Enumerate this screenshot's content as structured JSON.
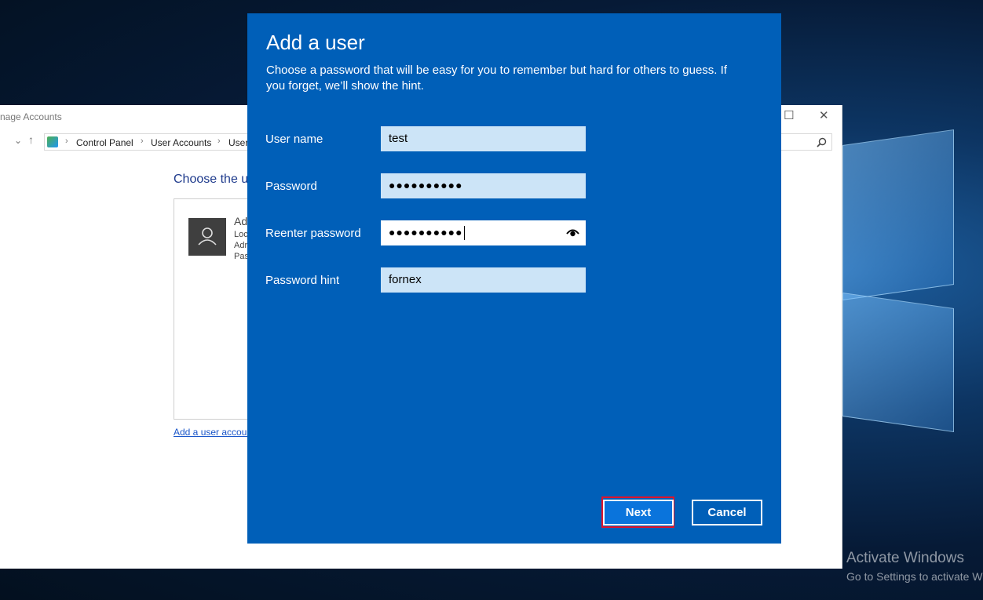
{
  "background_window": {
    "title": "nage Accounts",
    "breadcrumb": [
      "Control Panel",
      "User Accounts",
      "User"
    ],
    "heading": "Choose the us",
    "account_name": "Ad",
    "account_lines": [
      "Loc",
      "Adr",
      "Pas"
    ],
    "add_link": "Add a user accoun"
  },
  "dialog": {
    "title": "Add a user",
    "description": "Choose a password that will be easy for you to remember but hard for others to guess. If you forget, we’ll show the hint.",
    "fields": [
      {
        "label": "User name",
        "value": "test"
      },
      {
        "label": "Password",
        "value": "●●●●●●●●●●"
      },
      {
        "label": "Reenter password",
        "value": "●●●●●●●●●●"
      },
      {
        "label": "Password hint",
        "value": "fornex"
      }
    ],
    "next_label": "Next",
    "cancel_label": "Cancel"
  },
  "watermark": {
    "title": "Activate Windows",
    "subtitle": "Go to Settings to activate W"
  },
  "colors": {
    "dialog_bg": "#005fb8",
    "input_bg": "#cce4f7",
    "focus_outline": "#e0142b"
  },
  "icons": [
    "eye-icon",
    "user-avatar-icon",
    "search-icon",
    "up-arrow-icon",
    "maximize-icon",
    "close-icon"
  ]
}
